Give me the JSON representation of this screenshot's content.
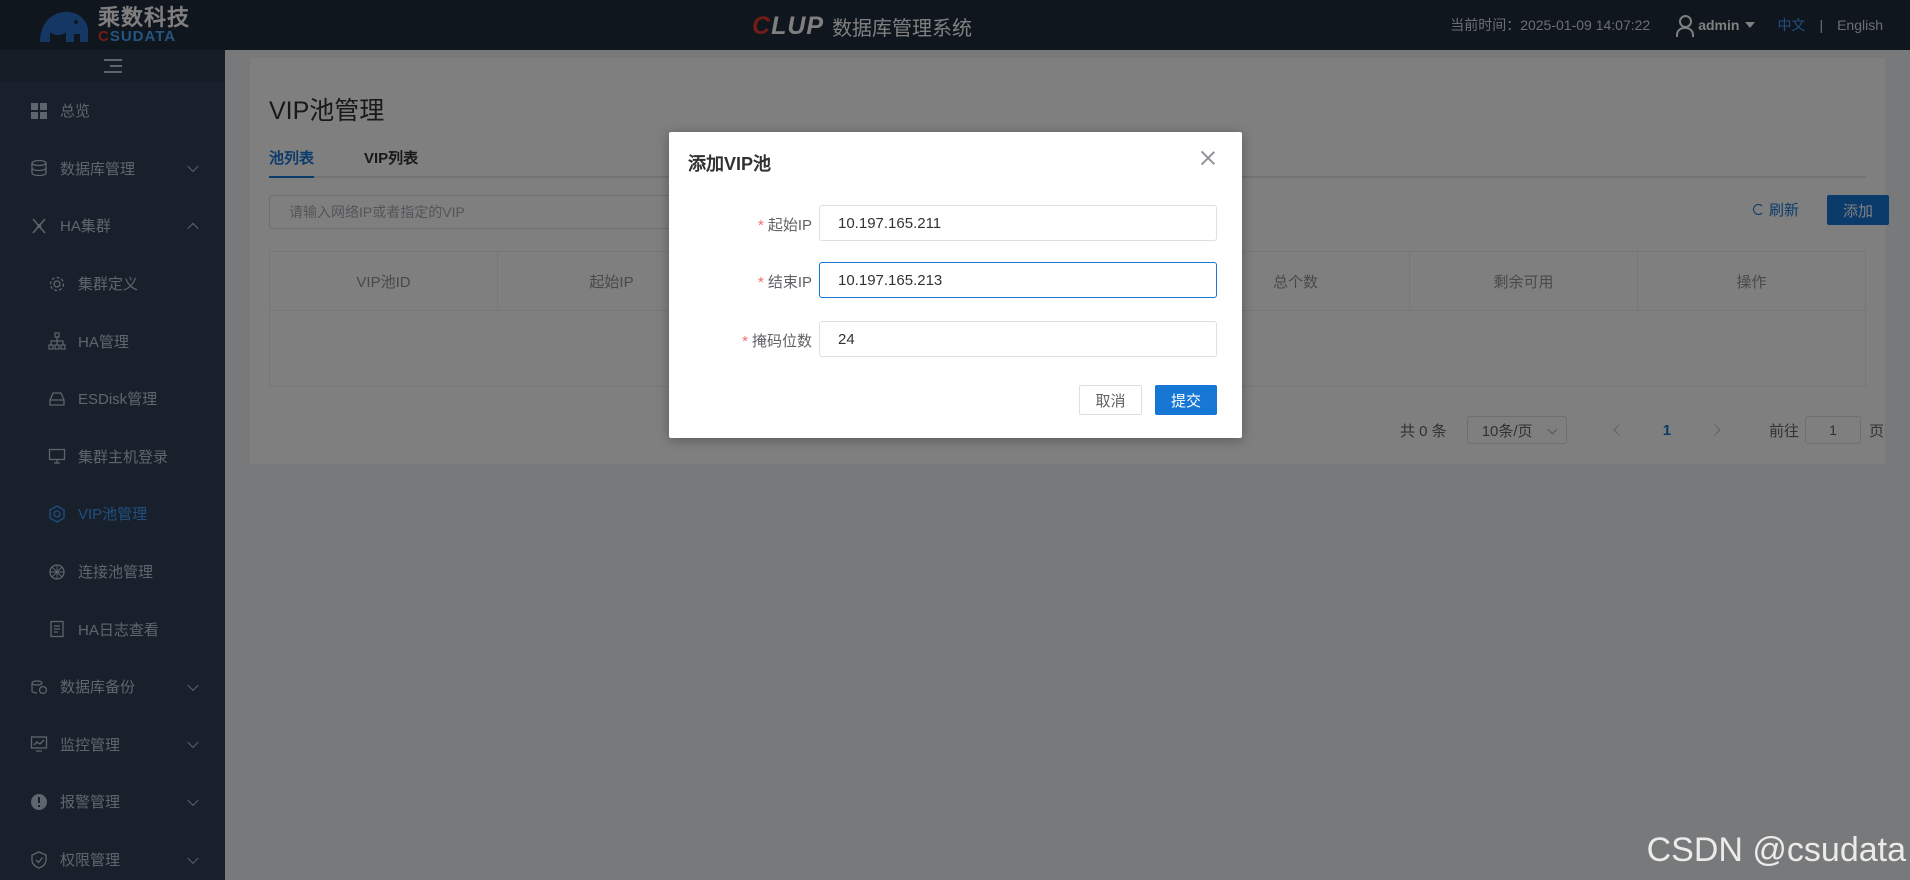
{
  "header": {
    "logo_cn": "乘数科技",
    "logo_en_c": "C",
    "logo_en_rest": "SUDATA",
    "product_c": "C",
    "product_rest": "LUP",
    "system_name": "数据库管理系统",
    "time_label": "当前时间：2025-01-09 14:07:22",
    "username": "admin",
    "lang_cn": "中文",
    "lang_sep": "|",
    "lang_en": "English"
  },
  "sidebar": {
    "items": [
      {
        "label": "总览",
        "icon": "grid-icon"
      },
      {
        "label": "数据库管理",
        "icon": "database-icon"
      },
      {
        "label": "HA集群",
        "icon": "ha-cluster-icon"
      },
      {
        "label": "集群定义",
        "icon": "gear-icon"
      },
      {
        "label": "HA管理",
        "icon": "sitemap-icon"
      },
      {
        "label": "ESDisk管理",
        "icon": "disk-icon"
      },
      {
        "label": "集群主机登录",
        "icon": "monitor-icon"
      },
      {
        "label": "VIP池管理",
        "icon": "hexagon-icon"
      },
      {
        "label": "连接池管理",
        "icon": "pool-icon"
      },
      {
        "label": "HA日志查看",
        "icon": "document-icon"
      },
      {
        "label": "数据库备份",
        "icon": "backup-icon"
      },
      {
        "label": "监控管理",
        "icon": "monitor-chart-icon"
      },
      {
        "label": "报警管理",
        "icon": "alert-icon"
      },
      {
        "label": "权限管理",
        "icon": "shield-icon"
      }
    ]
  },
  "page": {
    "title": "VIP池管理",
    "tabs": [
      {
        "label": "池列表"
      },
      {
        "label": "VIP列表"
      }
    ],
    "search_placeholder": "请输入网络IP或者指定的VIP",
    "refresh_label": "刷新",
    "add_label": "添加",
    "table_headers": [
      "VIP池ID",
      "起始IP",
      "",
      "",
      "总个数",
      "剩余可用",
      "操作"
    ],
    "pagination": {
      "total": "共 0 条",
      "page_size": "10条/页",
      "current": "1",
      "goto_label": "前往",
      "goto_value": "1",
      "page_suffix": "页"
    }
  },
  "dialog": {
    "title": "添加VIP池",
    "fields": [
      {
        "label": "起始IP",
        "value": "10.197.165.211"
      },
      {
        "label": "结束IP",
        "value": "10.197.165.213"
      },
      {
        "label": "掩码位数",
        "value": "24"
      }
    ],
    "cancel_label": "取消",
    "submit_label": "提交"
  },
  "watermark": "CSDN @csudata",
  "colors": {
    "primary": "#1677d4",
    "sidebar_bg": "#304156",
    "topbar_bg": "#1f2d3d",
    "required": "#f56c6c"
  }
}
